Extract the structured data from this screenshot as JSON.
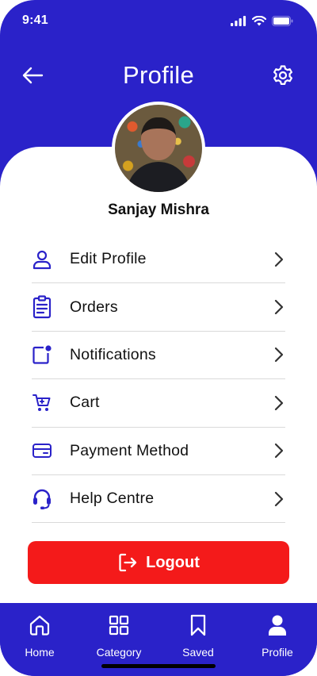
{
  "status_bar": {
    "time": "9:41",
    "signal_icon": "cellular-signal-icon",
    "wifi_icon": "wifi-icon",
    "battery_icon": "battery-icon"
  },
  "header": {
    "title": "Profile",
    "back_icon": "arrow-left-icon",
    "settings_icon": "gear-icon"
  },
  "profile": {
    "name": "Sanjay Mishra",
    "avatar_icon": "avatar-photo"
  },
  "menu": {
    "items": [
      {
        "label": "Edit Profile",
        "icon": "user-icon"
      },
      {
        "label": "Orders",
        "icon": "clipboard-icon"
      },
      {
        "label": "Notifications",
        "icon": "notification-icon"
      },
      {
        "label": "Cart",
        "icon": "cart-icon"
      },
      {
        "label": "Payment Method",
        "icon": "credit-card-icon"
      },
      {
        "label": "Help Centre",
        "icon": "headset-icon"
      }
    ]
  },
  "logout": {
    "label": "Logout",
    "icon": "logout-icon"
  },
  "bottom_nav": {
    "items": [
      {
        "label": "Home",
        "icon": "home-icon"
      },
      {
        "label": "Category",
        "icon": "grid-icon"
      },
      {
        "label": "Saved",
        "icon": "bookmark-icon"
      },
      {
        "label": "Profile",
        "icon": "person-icon"
      }
    ]
  },
  "colors": {
    "primary": "#2a22c9",
    "logout": "#f41a1a",
    "text": "#111111",
    "divider": "#d9d9d9"
  }
}
